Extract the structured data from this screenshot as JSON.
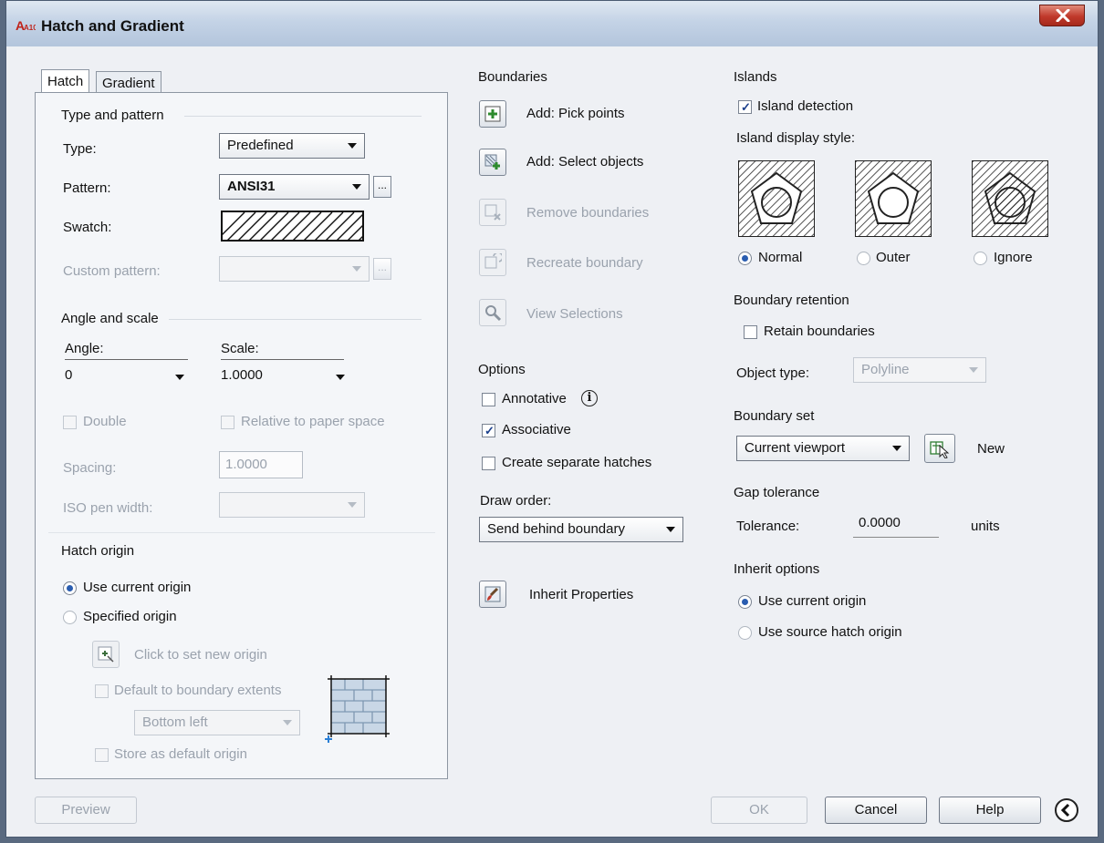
{
  "window": {
    "title": "Hatch and Gradient",
    "app_icon_text": "A10"
  },
  "tabs": [
    {
      "label": "Hatch"
    },
    {
      "label": "Gradient"
    }
  ],
  "type_pattern": {
    "group_title": "Type and pattern",
    "type_label": "Type:",
    "type_value": "Predefined",
    "pattern_label": "Pattern:",
    "pattern_value": "ANSI31",
    "ellipsis": "...",
    "swatch_label": "Swatch:",
    "custom_pattern_label": "Custom pattern:",
    "custom_pattern_value": ""
  },
  "angle_scale": {
    "group_title": "Angle and scale",
    "angle_label": "Angle:",
    "angle_value": "0",
    "scale_label": "Scale:",
    "scale_value": "1.0000",
    "double_label": "Double",
    "relative_label": "Relative to paper space",
    "spacing_label": "Spacing:",
    "spacing_value": "1.0000",
    "iso_label": "ISO pen width:",
    "iso_value": ""
  },
  "hatch_origin": {
    "group_title": "Hatch origin",
    "use_current": "Use current origin",
    "specified": "Specified origin",
    "click_to_set": "Click to set new origin",
    "default_extents": "Default to boundary extents",
    "position_value": "Bottom left",
    "store_default": "Store as default origin"
  },
  "boundaries": {
    "group_title": "Boundaries",
    "add_pick": "Add: Pick points",
    "add_select": "Add: Select objects",
    "remove": "Remove boundaries",
    "recreate": "Recreate boundary",
    "view": "View Selections"
  },
  "options": {
    "group_title": "Options",
    "annotative": "Annotative",
    "associative": "Associative",
    "separate": "Create separate hatches",
    "draw_order_label": "Draw order:",
    "draw_order_value": "Send behind boundary",
    "inherit": "Inherit Properties"
  },
  "islands": {
    "group_title": "Islands",
    "detection": "Island detection",
    "display_style_label": "Island display style:",
    "styles": [
      "Normal",
      "Outer",
      "Ignore"
    ],
    "selected_style": "Normal"
  },
  "boundary_retention": {
    "group_title": "Boundary retention",
    "retain": "Retain boundaries",
    "object_type_label": "Object type:",
    "object_type_value": "Polyline"
  },
  "boundary_set": {
    "group_title": "Boundary set",
    "value": "Current viewport",
    "new_label": "New"
  },
  "gap_tolerance": {
    "group_title": "Gap tolerance",
    "tolerance_label": "Tolerance:",
    "tolerance_value": "0.0000",
    "units": "units"
  },
  "inherit_options": {
    "group_title": "Inherit options",
    "use_current": "Use current origin",
    "use_source": "Use source hatch origin"
  },
  "buttons": {
    "preview": "Preview",
    "ok": "OK",
    "cancel": "Cancel",
    "help": "Help"
  },
  "colors": {
    "accent": "#2a5db0",
    "title_bar": "#c4d3e6",
    "close": "#c0392b"
  }
}
